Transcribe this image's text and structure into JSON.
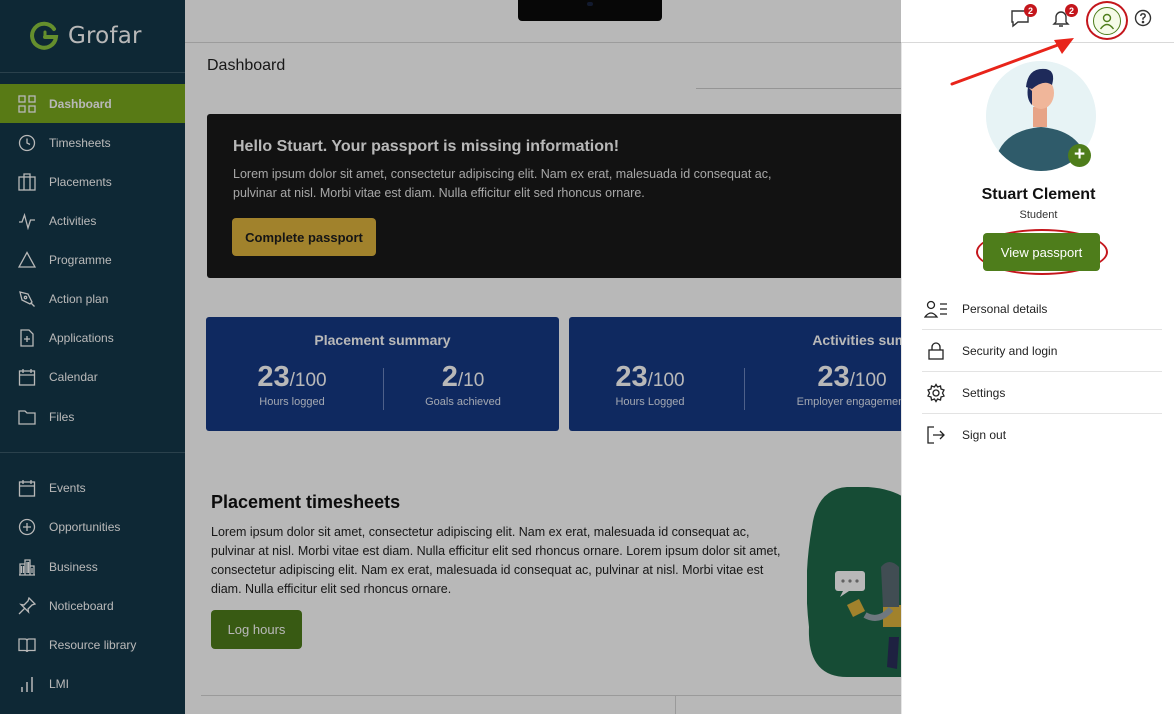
{
  "brand": {
    "name": "Grofar",
    "accent": "#7aaa1e",
    "primary_green": "#4e7d1b",
    "sidebar_bg": "#14384a",
    "card_blue": "#163a86",
    "annotation_red": "#c4161c"
  },
  "sidebar": {
    "items": [
      {
        "label": "Dashboard",
        "icon": "grid-icon",
        "active": true
      },
      {
        "label": "Timesheets",
        "icon": "clock-icon"
      },
      {
        "label": "Placements",
        "icon": "building-icon"
      },
      {
        "label": "Activities",
        "icon": "pulse-icon"
      },
      {
        "label": "Programme",
        "icon": "triangle-icon"
      },
      {
        "label": "Action plan",
        "icon": "pen-tool-icon"
      },
      {
        "label": "Applications",
        "icon": "file-plus-icon"
      },
      {
        "label": "Calendar",
        "icon": "calendar-icon"
      },
      {
        "label": "Files",
        "icon": "folder-icon"
      }
    ],
    "secondary_items": [
      {
        "label": "Events",
        "icon": "calendar-icon"
      },
      {
        "label": "Opportunities",
        "icon": "plus-circle-icon"
      },
      {
        "label": "Business",
        "icon": "city-icon"
      },
      {
        "label": "Noticeboard",
        "icon": "pin-icon"
      },
      {
        "label": "Resource library",
        "icon": "book-icon"
      },
      {
        "label": "LMI",
        "icon": "bar-chart-icon"
      }
    ]
  },
  "header": {
    "messages_badge": "2",
    "notifications_badge": "2"
  },
  "main": {
    "page_title": "Dashboard",
    "banner": {
      "heading": "Hello Stuart. Your passport is missing information!",
      "body": "Lorem ipsum dolor sit amet, consectetur adipiscing elit. Nam ex erat, malesuada id consequat ac, pulvinar at nisl. Morbi vitae est diam. Nulla efficitur elit sed rhoncus ornare.",
      "button": "Complete passport"
    },
    "cards": [
      {
        "title": "Placement summary",
        "stats": [
          {
            "value": "23",
            "total": "/100",
            "label": "Hours logged"
          },
          {
            "value": "2",
            "total": "/10",
            "label": "Goals achieved"
          }
        ]
      },
      {
        "title": "Activities summ",
        "stats": [
          {
            "value": "23",
            "total": "/100",
            "label": "Hours Logged"
          },
          {
            "value": "23",
            "total": "/100",
            "label": "Employer engagement"
          }
        ]
      }
    ],
    "timesheets": {
      "title": "Placement timesheets",
      "body": "Lorem ipsum dolor sit amet, consectetur adipiscing elit. Nam ex erat, malesuada id consequat ac, pulvinar at nisl. Morbi vitae est diam. Nulla efficitur elit sed rhoncus ornare. Lorem ipsum dolor sit amet, consectetur adipiscing elit. Nam ex erat, malesuada id consequat ac, pulvinar at nisl. Morbi vitae est diam. Nulla efficitur elit sed rhoncus ornare.",
      "button": "Log hours"
    }
  },
  "profile_panel": {
    "name": "Stuart Clement",
    "role": "Student",
    "button": "View passport",
    "menu": [
      {
        "label": "Personal details",
        "icon": "user-list-icon"
      },
      {
        "label": "Security and login",
        "icon": "lock-icon"
      },
      {
        "label": "Settings",
        "icon": "gear-icon"
      },
      {
        "label": "Sign out",
        "icon": "sign-out-icon"
      }
    ]
  }
}
